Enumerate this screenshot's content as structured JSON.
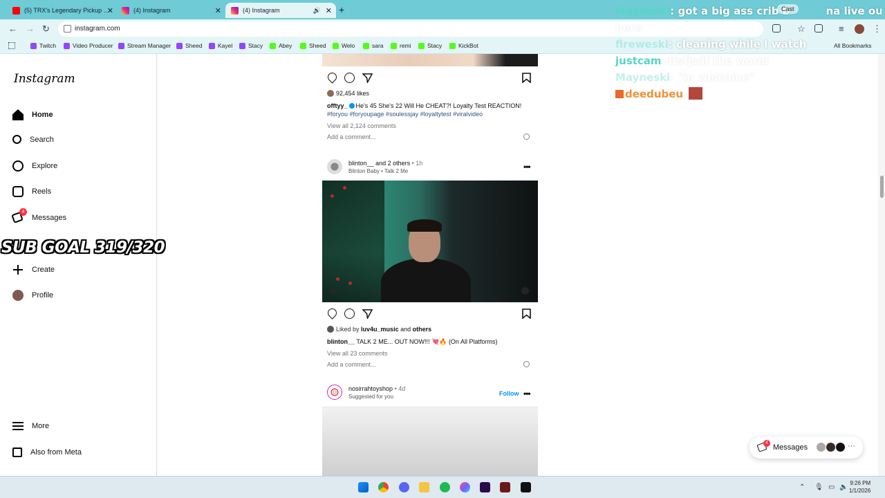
{
  "browser": {
    "tabs": [
      {
        "title": "(5) TRX's Legendary Pickup Tru",
        "icon": "youtube-icon"
      },
      {
        "title": "(4) Instagram",
        "icon": "instagram-icon"
      },
      {
        "title": "(4) Instagram",
        "icon": "instagram-icon",
        "active": true
      }
    ],
    "url": "instagram.com",
    "bookmarks": [
      {
        "label": "Twitch",
        "icon": "twitch-icon"
      },
      {
        "label": "Video Producer",
        "icon": "twitch-icon"
      },
      {
        "label": "Stream Manager",
        "icon": "twitch-icon"
      },
      {
        "label": "Sheed",
        "icon": "twitch-icon"
      },
      {
        "label": "Kayel",
        "icon": "twitch-icon"
      },
      {
        "label": "Stacy",
        "icon": "twitch-icon"
      },
      {
        "label": "Abey",
        "icon": "kick-icon"
      },
      {
        "label": "Sheed",
        "icon": "kick-icon"
      },
      {
        "label": "Welo",
        "icon": "kick-icon"
      },
      {
        "label": "sara",
        "icon": "kick-icon"
      },
      {
        "label": "remi",
        "icon": "kick-icon"
      },
      {
        "label": "Stacy",
        "icon": "kick-icon"
      },
      {
        "label": "KickBot",
        "icon": "kick-icon"
      }
    ],
    "all_bookmarks": "All Bookmarks"
  },
  "sidebar": {
    "logo": "Instagram",
    "items": [
      {
        "label": "Home",
        "icon": "home-icon"
      },
      {
        "label": "Search",
        "icon": "search-icon"
      },
      {
        "label": "Explore",
        "icon": "explore-icon"
      },
      {
        "label": "Reels",
        "icon": "reels-icon"
      },
      {
        "label": "Messages",
        "icon": "messages-icon",
        "badge": "4"
      },
      {
        "label": "Create",
        "icon": "create-icon"
      },
      {
        "label": "Profile",
        "icon": "profile-icon"
      }
    ],
    "more": "More",
    "also_from_meta": "Also from Meta"
  },
  "overlay": {
    "sub_goal": "SUB GOAL 319/320"
  },
  "feed": {
    "post1": {
      "likes": "92,454 likes",
      "user": "offtyy_",
      "caption": "He's 45 She's 22 Will He CHEAT?! Loyalty Test REACTION!",
      "hashtags": "#foryou #foryoupage #soulessjay #loyaltytest #viralvideo",
      "view_comments": "View all 2,124 comments",
      "add_comment": "Add a comment..."
    },
    "post2": {
      "user": "blinton__",
      "coauthors": "and 2 others",
      "time": "• 1h",
      "audio": "Blinton Baby • Talk 2 Me",
      "liked_prefix": "Liked by",
      "liked_user": "luv4u_music",
      "liked_suffix": "and",
      "liked_others": "others",
      "caption_user": "blinton__",
      "caption": "TALK 2 ME... OUT NOW!!! 💘🔥 (On All Platforms)",
      "view_comments": "View all 23 comments",
      "add_comment": "Add a comment..."
    },
    "post3": {
      "user": "nosirrahtoyshop",
      "time": "• 4d",
      "sub": "Suggested for you",
      "follow": "Follow"
    }
  },
  "chat": [
    {
      "name": "Mayneski",
      "text": "got a big ass crib b",
      "tail": "na live out"
    },
    {
      "name": "",
      "text": "here",
      "faint": true
    },
    {
      "name": "fireweski",
      "text": ": cleaning while I watch",
      "faint_name": true
    },
    {
      "name": "justcam",
      "text": "dfsfjsdf the world",
      "faint": true
    },
    {
      "name": "Mayneski",
      "text": ": \"in welcome\"",
      "faint": true
    },
    {
      "name": "deedubeu",
      "text": ""
    }
  ],
  "cast": "Cast",
  "messages_pill": {
    "label": "Messages",
    "badge": "4"
  },
  "taskbar": {
    "time": "9:26 PM",
    "date": "1/1/2026"
  }
}
